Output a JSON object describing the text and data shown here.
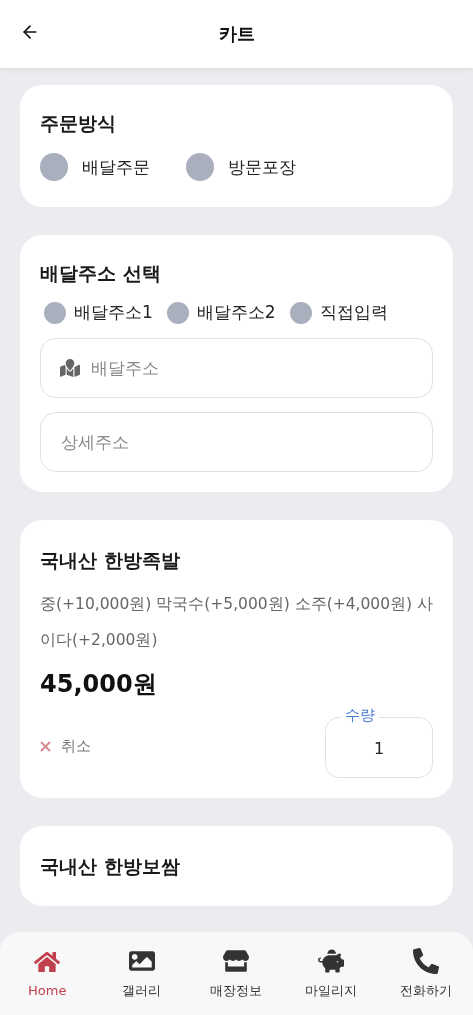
{
  "header": {
    "title": "카트"
  },
  "order_method": {
    "title": "주문방식",
    "options": [
      {
        "label": "배달주문",
        "selected": false
      },
      {
        "label": "방문포장",
        "selected": false
      }
    ]
  },
  "address": {
    "title": "배달주소 선택",
    "options": [
      {
        "label": "배달주소1",
        "selected": false
      },
      {
        "label": "배달주소2",
        "selected": false
      },
      {
        "label": "직접입력",
        "selected": false
      }
    ],
    "fields": [
      {
        "placeholder": "배달주소",
        "kind": "map"
      },
      {
        "placeholder": "상세주소",
        "kind": "plain"
      }
    ]
  },
  "items": [
    {
      "name": "국내산 한방족발",
      "options": "중(+10,000원) 막국수(+5,000원) 소주(+4,000원) 사이다(+2,000원)",
      "price": "45,000원",
      "cancel": "취소",
      "quantity_label": "수량",
      "quantity": "1"
    },
    {
      "name": "국내산 한방보쌈"
    }
  ],
  "nav": [
    {
      "label": "Home",
      "selected": true
    },
    {
      "label": "갤러리",
      "selected": false
    },
    {
      "label": "매장정보",
      "selected": false
    },
    {
      "label": "마일리지",
      "selected": false
    },
    {
      "label": "전화하기",
      "selected": false
    }
  ]
}
